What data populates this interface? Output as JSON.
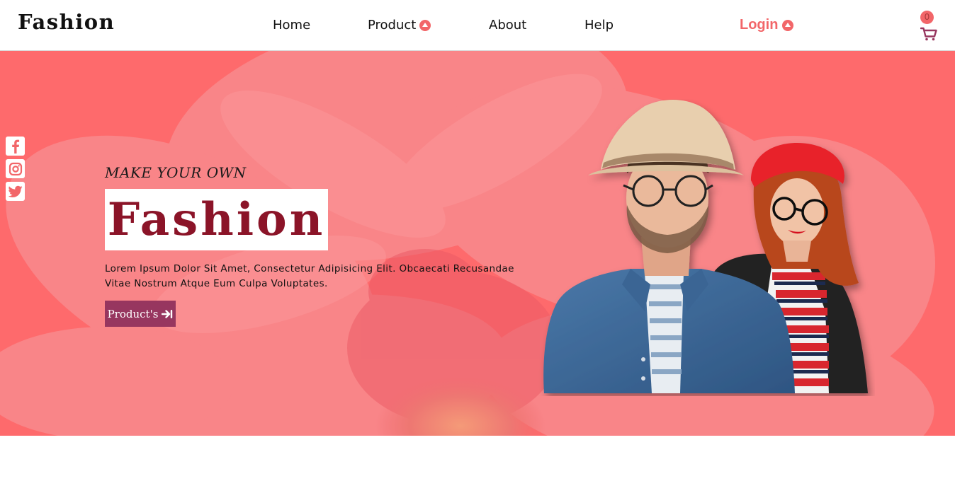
{
  "colors": {
    "accent": "#f26669",
    "hero_bg": "#fe6a6c",
    "title": "#8b1428",
    "cta_bg": "#97365f",
    "text": "#111111"
  },
  "header": {
    "brand": "Fashion",
    "nav": [
      {
        "label": "Home",
        "icon": ""
      },
      {
        "label": "Product",
        "icon": "chevron-up-icon"
      },
      {
        "label": "About",
        "icon": ""
      },
      {
        "label": "Help",
        "icon": ""
      }
    ],
    "login": {
      "label": "Login",
      "icon": "chevron-up-icon"
    },
    "cart": {
      "count": "0",
      "icon": "cart-icon"
    }
  },
  "social": [
    {
      "icon": "facebook-icon"
    },
    {
      "icon": "instagram-icon"
    },
    {
      "icon": "twitter-icon"
    }
  ],
  "hero": {
    "tagline": "MAKE YOUR OWN",
    "title": "Fashion",
    "description_line1": "Lorem Ipsum Dolor Sit Amet, Consectetur Adipisicing Elit. Obcaecati Recusandae",
    "description_line2": "Vitae Nostrum Atque Eum Culpa Voluptates.",
    "cta_label": "Product's",
    "cta_icon": "arrow-right-to-bar-icon"
  }
}
